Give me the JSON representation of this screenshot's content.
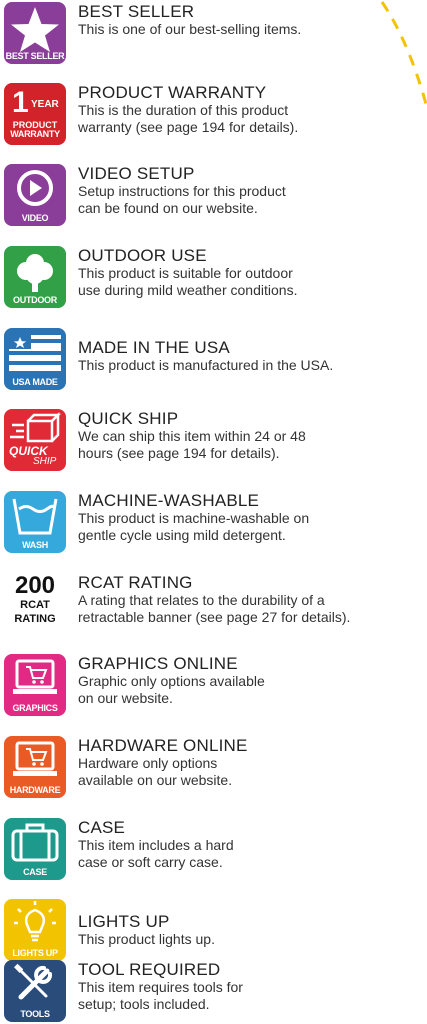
{
  "colors": {
    "best_seller": "#8b3d9a",
    "warranty": "#d2232a",
    "video": "#8b3d9a",
    "outdoor": "#32a047",
    "usa": "#2a73b5",
    "quick_ship": "#e02a35",
    "wash": "#36a9dc",
    "rcat": "#111111",
    "graphics": "#e22a84",
    "hardware": "#ea5a25",
    "case": "#1e9a8c",
    "lights": "#f2c300",
    "tools": "#2a4c7a",
    "dash": "#f2c300"
  },
  "items": [
    {
      "icon": "star-icon",
      "caption": "BEST SELLER",
      "title": "BEST SELLER",
      "lines": [
        "This is one of our best-selling items."
      ]
    },
    {
      "icon": "warranty-icon",
      "caption": "WARRANTY",
      "caption_num": "1",
      "caption_top": "YEAR",
      "caption_mid": "PRODUCT",
      "title": "PRODUCT WARRANTY",
      "lines": [
        "This is the duration of this product",
        "warranty (see page 194 for details)."
      ]
    },
    {
      "icon": "play-icon",
      "caption": "VIDEO",
      "title": "VIDEO SETUP",
      "lines": [
        "Setup instructions for this product",
        "can be found on our website."
      ]
    },
    {
      "icon": "tree-icon",
      "caption": "OUTDOOR",
      "title": "OUTDOOR USE",
      "lines": [
        "This product is suitable for outdoor",
        "use during mild weather conditions."
      ]
    },
    {
      "icon": "flag-icon",
      "caption": "USA MADE",
      "title": "MADE IN THE USA",
      "lines": [
        "This product is manufactured in the USA."
      ]
    },
    {
      "icon": "shipping-box-icon",
      "caption": "QUICK",
      "caption2": "SHIP",
      "title": "QUICK SHIP",
      "lines": [
        "We can ship this item within 24 or 48",
        "hours (see page 194 for details)."
      ]
    },
    {
      "icon": "wash-tub-icon",
      "caption": "WASH",
      "title": "MACHINE-WASHABLE",
      "lines": [
        "This product is machine-washable on",
        "gentle cycle using mild detergent."
      ]
    },
    {
      "icon": "rating-icon",
      "caption": "RATING",
      "caption_num": "200",
      "caption_mid": "RCAT",
      "title": "RCAT RATING",
      "lines": [
        "A rating that relates to the durability of a",
        "retractable banner (see page 27 for details)."
      ]
    },
    {
      "icon": "cart-icon",
      "caption": "GRAPHICS",
      "title": "GRAPHICS ONLINE",
      "lines": [
        "Graphic only options available",
        "on our website."
      ]
    },
    {
      "icon": "cart-icon",
      "caption": "HARDWARE",
      "title": "HARDWARE ONLINE",
      "lines": [
        "Hardware only options",
        "available on our website."
      ]
    },
    {
      "icon": "case-icon",
      "caption": "CASE",
      "title": "CASE",
      "lines": [
        "This item includes a hard",
        "case or soft carry case."
      ]
    },
    {
      "icon": "bulb-icon",
      "caption": "LIGHTS UP",
      "title": "LIGHTS UP",
      "lines": [
        "This product lights up."
      ]
    },
    {
      "icon": "tools-icon",
      "caption": "TOOLS",
      "title": "TOOL REQUIRED",
      "lines": [
        "This item requires tools for",
        "setup; tools included."
      ]
    }
  ]
}
